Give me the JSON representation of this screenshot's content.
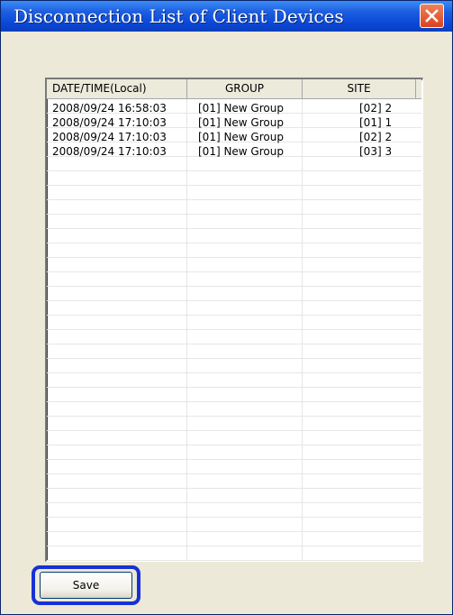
{
  "window": {
    "title": "Disconnection List of Client Devices"
  },
  "list": {
    "columns": [
      "DATE/TIME(Local)",
      "GROUP",
      "SITE"
    ],
    "rows": [
      [
        "2008/09/24 16:58:03",
        "[01] New Group",
        "[02] 2"
      ],
      [
        "2008/09/24 17:10:03",
        "[01] New Group",
        "[01] 1"
      ],
      [
        "2008/09/24 17:10:03",
        "[01] New Group",
        "[02] 2"
      ],
      [
        "2008/09/24 17:10:03",
        "[01] New Group",
        "[03] 3"
      ]
    ]
  },
  "buttons": {
    "save_label": "Save"
  },
  "icons": {
    "close": "close-icon"
  },
  "colors": {
    "title_bar": "#0a46d8",
    "close_button": "#d9421c",
    "dialog_bg": "#ece9d8",
    "highlight": "#1830d6"
  }
}
